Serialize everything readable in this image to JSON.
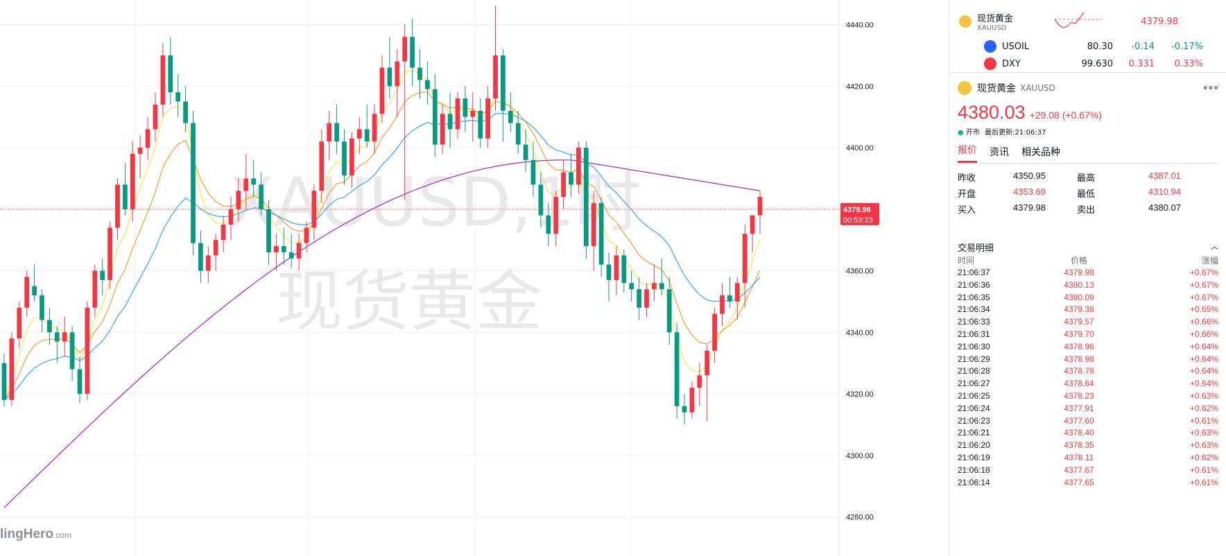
{
  "watermark": {
    "line1": "XAUUSD,1时",
    "line2": "现货黄金"
  },
  "brand": {
    "name": "lingHero",
    "suffix": ".com"
  },
  "watchlist": [
    {
      "name": "现货黄金",
      "sub": "XAUUSD",
      "last": "4379.98",
      "icon_color": "#f4c542"
    },
    {
      "name": "USOIL",
      "last": "80.30",
      "change": "-0.14",
      "pct": "-0.17%",
      "icon_color": "#2962ff"
    },
    {
      "name": "DXY",
      "last": "99.630",
      "change": "0.331",
      "pct": "0.33%",
      "icon_color": "#f23645"
    }
  ],
  "details": {
    "name": "现货黄金",
    "symbol": "XAUUSD",
    "more": "∘∘∘",
    "price": "4380.03",
    "change": "+29.08 (+0.67%)",
    "status_dot": "●",
    "status": "开市",
    "updated": "最后更新:21:06:37",
    "tabs": [
      "报价",
      "资讯",
      "相关品种"
    ],
    "stats": [
      {
        "label": "昨收",
        "value": "4350.95",
        "label2": "最高",
        "value2": "4387.01"
      },
      {
        "label": "开盘",
        "value": "4353.69",
        "label2": "最低",
        "value2": "4310.94"
      },
      {
        "label": "买入",
        "value": "4379.98",
        "label2": "卖出",
        "value2": "4380.07"
      }
    ],
    "trades_title": "交易明细",
    "trades_cols": {
      "time": "时间",
      "price": "价格",
      "change": "涨幅"
    },
    "trades": [
      [
        "21:06:37",
        "4379.98",
        "+0.67%"
      ],
      [
        "21:06:36",
        "4380.13",
        "+0.67%"
      ],
      [
        "21:06:35",
        "4380.09",
        "+0.67%"
      ],
      [
        "21:06:34",
        "4379.38",
        "+0.65%"
      ],
      [
        "21:06:33",
        "4379.57",
        "+0.66%"
      ],
      [
        "21:06:31",
        "4379.70",
        "+0.66%"
      ],
      [
        "21:06:30",
        "4378.96",
        "+0.64%"
      ],
      [
        "21:06:29",
        "4378.98",
        "+0.64%"
      ],
      [
        "21:06:28",
        "4378.78",
        "+0.64%"
      ],
      [
        "21:06:27",
        "4378.64",
        "+0.64%"
      ],
      [
        "21:06:25",
        "4378.23",
        "+0.63%"
      ],
      [
        "21:06:24",
        "4377.91",
        "+0.62%"
      ],
      [
        "21:06:23",
        "4377.60",
        "+0.61%"
      ],
      [
        "21:06:21",
        "4378.40",
        "+0.63%"
      ],
      [
        "21:06:20",
        "4378.35",
        "+0.63%"
      ],
      [
        "21:06:19",
        "4378.11",
        "+0.62%"
      ],
      [
        "21:06:18",
        "4377.67",
        "+0.61%"
      ],
      [
        "21:06:14",
        "4377.65",
        "+0.61%"
      ]
    ]
  },
  "chart_data": {
    "type": "candlestick",
    "symbol": "XAUUSD",
    "interval": "1时",
    "ylim": [
      4270,
      4448
    ],
    "yticks": [
      4280,
      4300,
      4320,
      4340,
      4360,
      4380,
      4400,
      4420,
      4440
    ],
    "current_price": "4379.98",
    "countdown": "00:53:23",
    "colors": {
      "up": "#f23645",
      "down": "#089981",
      "ma_fast": "#f5e94a",
      "ma_mid": "#f0a030",
      "ma_slow": "#3ca5e8",
      "ma_long": "#9c27b0"
    },
    "candles": [
      [
        4330,
        4333,
        4316,
        4318
      ],
      [
        4318,
        4340,
        4316,
        4338
      ],
      [
        4338,
        4350,
        4335,
        4348
      ],
      [
        4348,
        4360,
        4345,
        4358
      ],
      [
        4355,
        4362,
        4350,
        4352
      ],
      [
        4352,
        4354,
        4340,
        4344
      ],
      [
        4344,
        4348,
        4336,
        4340
      ],
      [
        4340,
        4342,
        4330,
        4337
      ],
      [
        4337,
        4345,
        4332,
        4340
      ],
      [
        4340,
        4342,
        4324,
        4328
      ],
      [
        4328,
        4332,
        4317,
        4320
      ],
      [
        4320,
        4350,
        4318,
        4348
      ],
      [
        4348,
        4362,
        4345,
        4360
      ],
      [
        4360,
        4364,
        4352,
        4357
      ],
      [
        4357,
        4376,
        4354,
        4374
      ],
      [
        4374,
        4390,
        4370,
        4388
      ],
      [
        4388,
        4395,
        4378,
        4380
      ],
      [
        4380,
        4402,
        4376,
        4398
      ],
      [
        4398,
        4404,
        4390,
        4400
      ],
      [
        4400,
        4410,
        4396,
        4406
      ],
      [
        4406,
        4418,
        4402,
        4414
      ],
      [
        4414,
        4434,
        4410,
        4430
      ],
      [
        4430,
        4436,
        4414,
        4418
      ],
      [
        4418,
        4424,
        4410,
        4415
      ],
      [
        4415,
        4420,
        4405,
        4408
      ],
      [
        4408,
        4412,
        4365,
        4369
      ],
      [
        4369,
        4373,
        4356,
        4360
      ],
      [
        4360,
        4368,
        4356,
        4365
      ],
      [
        4365,
        4372,
        4360,
        4370
      ],
      [
        4370,
        4378,
        4366,
        4375
      ],
      [
        4375,
        4384,
        4370,
        4380
      ],
      [
        4380,
        4390,
        4376,
        4386
      ],
      [
        4386,
        4398,
        4380,
        4390
      ],
      [
        4390,
        4396,
        4384,
        4388
      ],
      [
        4388,
        4392,
        4378,
        4380
      ],
      [
        4380,
        4383,
        4362,
        4366
      ],
      [
        4366,
        4372,
        4360,
        4368
      ],
      [
        4368,
        4374,
        4362,
        4366
      ],
      [
        4366,
        4372,
        4361,
        4364
      ],
      [
        4364,
        4372,
        4360,
        4369
      ],
      [
        4369,
        4376,
        4366,
        4374
      ],
      [
        4374,
        4388,
        4370,
        4386
      ],
      [
        4386,
        4406,
        4382,
        4402
      ],
      [
        4402,
        4412,
        4396,
        4408
      ],
      [
        4408,
        4414,
        4398,
        4402
      ],
      [
        4402,
        4406,
        4388,
        4391
      ],
      [
        4391,
        4405,
        4387,
        4403
      ],
      [
        4403,
        4410,
        4398,
        4406
      ],
      [
        4406,
        4414,
        4400,
        4402
      ],
      [
        4402,
        4414,
        4398,
        4411
      ],
      [
        4411,
        4430,
        4408,
        4426
      ],
      [
        4426,
        4436,
        4416,
        4420
      ],
      [
        4420,
        4432,
        4410,
        4428
      ],
      [
        4428,
        4440,
        4383,
        4436
      ],
      [
        4436,
        4442,
        4420,
        4426
      ],
      [
        4426,
        4432,
        4416,
        4422
      ],
      [
        4422,
        4428,
        4414,
        4419
      ],
      [
        4419,
        4424,
        4397,
        4401
      ],
      [
        4401,
        4414,
        4398,
        4411
      ],
      [
        4411,
        4418,
        4400,
        4406
      ],
      [
        4406,
        4418,
        4403,
        4416
      ],
      [
        4416,
        4420,
        4405,
        4410
      ],
      [
        4410,
        4418,
        4402,
        4412
      ],
      [
        4412,
        4416,
        4400,
        4403
      ],
      [
        4403,
        4420,
        4400,
        4416
      ],
      [
        4416,
        4446,
        4412,
        4430
      ],
      [
        4430,
        4432,
        4402,
        4412
      ],
      [
        4412,
        4418,
        4405,
        4408
      ],
      [
        4408,
        4412,
        4398,
        4401
      ],
      [
        4401,
        4406,
        4392,
        4396
      ],
      [
        4396,
        4402,
        4384,
        4388
      ],
      [
        4388,
        4392,
        4374,
        4378
      ],
      [
        4378,
        4382,
        4368,
        4372
      ],
      [
        4372,
        4386,
        4368,
        4384
      ],
      [
        4384,
        4396,
        4380,
        4392
      ],
      [
        4392,
        4398,
        4384,
        4388
      ],
      [
        4388,
        4402,
        4385,
        4400
      ],
      [
        4400,
        4402,
        4364,
        4368
      ],
      [
        4368,
        4386,
        4360,
        4382
      ],
      [
        4382,
        4384,
        4358,
        4362
      ],
      [
        4362,
        4366,
        4350,
        4357
      ],
      [
        4357,
        4368,
        4352,
        4365
      ],
      [
        4365,
        4367,
        4353,
        4356
      ],
      [
        4356,
        4360,
        4350,
        4354
      ],
      [
        4354,
        4358,
        4344,
        4348
      ],
      [
        4348,
        4356,
        4345,
        4354
      ],
      [
        4354,
        4362,
        4350,
        4356
      ],
      [
        4356,
        4364,
        4352,
        4354
      ],
      [
        4354,
        4358,
        4336,
        4340
      ],
      [
        4340,
        4343,
        4312,
        4316
      ],
      [
        4316,
        4320,
        4310,
        4314
      ],
      [
        4314,
        4324,
        4312,
        4322
      ],
      [
        4322,
        4330,
        4316,
        4326
      ],
      [
        4326,
        4336,
        4311,
        4334
      ],
      [
        4334,
        4348,
        4330,
        4346
      ],
      [
        4346,
        4356,
        4342,
        4352
      ],
      [
        4352,
        4358,
        4348,
        4350
      ],
      [
        4350,
        4358,
        4344,
        4356
      ],
      [
        4356,
        4375,
        4348,
        4372
      ],
      [
        4372,
        4378,
        4366,
        4378
      ],
      [
        4378,
        4386,
        4372,
        4384
      ]
    ]
  }
}
